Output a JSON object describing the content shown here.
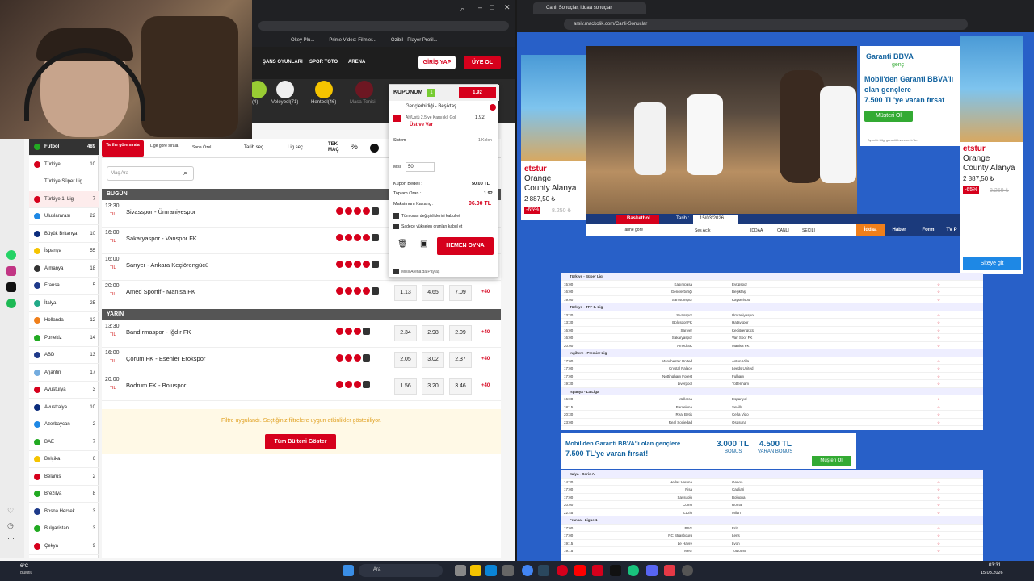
{
  "left_browser": {
    "bookmarks": [
      "Okey Plu...",
      "Prime Video: Filmler...",
      "Ozibil - Player Profil..."
    ],
    "header": {
      "nav": [
        "ŞANS OYUNLARI",
        "SPOR TOTO",
        "ARENA"
      ],
      "login": "GİRİŞ YAP",
      "signup": "ÜYE OL"
    },
    "sports": [
      {
        "label": "(4)"
      },
      {
        "label": "Voleybol(71)"
      },
      {
        "label": "Hentbol(46)"
      },
      {
        "label": "Masa Tenisi"
      }
    ],
    "filters": {
      "by_time": "Tarihe göre sırala",
      "by_league": "Lige göre sırala",
      "special": "Sana Özel",
      "date": "Tarih seç",
      "league": "Lig seç",
      "tek_mac": "TEK MAÇ",
      "search_placeholder": "Maç Ara"
    },
    "sidebar": [
      {
        "label": "Futbol",
        "count": "489"
      },
      {
        "label": "Türkiye",
        "count": "10"
      },
      {
        "label": "Türkiye Süper Lig",
        "count": ""
      },
      {
        "label": "Türkiye 1. Lig",
        "count": "7"
      },
      {
        "label": "Uluslararası",
        "count": "22"
      },
      {
        "label": "Büyük Britanya",
        "count": "10"
      },
      {
        "label": "İspanya",
        "count": "55"
      },
      {
        "label": "Almanya",
        "count": "18"
      },
      {
        "label": "Fransa",
        "count": "5"
      },
      {
        "label": "İtalya",
        "count": "25"
      },
      {
        "label": "Hollanda",
        "count": "12"
      },
      {
        "label": "Portekiz",
        "count": "14"
      },
      {
        "label": "ABD",
        "count": "13"
      },
      {
        "label": "Arjantin",
        "count": "17"
      },
      {
        "label": "Avusturya",
        "count": "3"
      },
      {
        "label": "Avustralya",
        "count": "10"
      },
      {
        "label": "Azerbaycan",
        "count": "2"
      },
      {
        "label": "BAE",
        "count": "7"
      },
      {
        "label": "Belçika",
        "count": "6"
      },
      {
        "label": "Belarus",
        "count": "2"
      },
      {
        "label": "Brezilya",
        "count": "8"
      },
      {
        "label": "Bosna Hersek",
        "count": "3"
      },
      {
        "label": "Bulgaristan",
        "count": "3"
      },
      {
        "label": "Çekya",
        "count": "9"
      }
    ],
    "today_label": "BUGÜN",
    "tomorrow_label": "YARIN",
    "today_matches": [
      {
        "time": "13:30",
        "tl": "TIL",
        "teams": "Sivasspor - Ümraniyespor",
        "o1": "",
        "ox": "",
        "o2": "",
        "plus": ""
      },
      {
        "time": "16:00",
        "tl": "TIL",
        "teams": "Sakaryaspor - Vanspor FK",
        "o1": "",
        "ox": "",
        "o2": "",
        "plus": ""
      },
      {
        "time": "16:00",
        "tl": "TIL",
        "teams": "Sarıyer - Ankara Keçiörengücü",
        "o1": "",
        "ox": "",
        "o2": "",
        "plus": ""
      },
      {
        "time": "20:00",
        "tl": "TIL",
        "teams": "Amed Sportif - Manisa FK",
        "o1": "1.13",
        "ox": "4.65",
        "o2": "7.09",
        "plus": "+40"
      }
    ],
    "tomorrow_matches": [
      {
        "time": "13:30",
        "tl": "TIL",
        "teams": "Bandırmaspor - Iğdır FK",
        "o1": "2.34",
        "ox": "2.98",
        "o2": "2.09",
        "plus": "+40"
      },
      {
        "time": "16:00",
        "tl": "TIL",
        "teams": "Çorum FK - Esenler Erokspor",
        "o1": "2.05",
        "ox": "3.02",
        "o2": "2.37",
        "plus": "+40"
      },
      {
        "time": "20:00",
        "tl": "TIL",
        "teams": "Bodrum FK - Boluspor",
        "o1": "1.56",
        "ox": "3.20",
        "o2": "3.46",
        "plus": "+40"
      }
    ],
    "filter_notice": "Filtre uygulandı. Seçtiğiniz filtrelere uygun etkinlikler gösteriliyor.",
    "all_bulletin": "Tüm Bülteni Göster",
    "coupon": {
      "title": "KUPONUM",
      "count": "1",
      "total_odd": "1.92",
      "match": "Gençlerbirliği - Beşiktaş",
      "bet": "Alt/Üstü 2.5 ve Karşılıklı Gol",
      "bet_odd": "1.92",
      "selection": "Üst ve Var",
      "system": "Sistem",
      "kolon": "1 Kolon",
      "misli_label": "Misli",
      "misli_value": "50",
      "bedel_label": "Kupon Bedeli :",
      "bedel_value": "50.00 TL",
      "oran_label": "Toplam Oran :",
      "oran_value": "1.92",
      "kazanc_label": "Maksimum Kazanç :",
      "kazanc_value": "96.00 TL",
      "check1": "Tüm oran değişikliklerini kabul et",
      "check2": "Sadece yükselen oranları kabul et",
      "play": "HEMEN OYNA",
      "share": "Misli Arena'da Paylaş"
    }
  },
  "right_browser": {
    "tab_title": "Canlı Sonuçlar, iddaa sonuçlar",
    "url": "arsiv.mackolik.com/Canli-Sonuclar",
    "ad_left": {
      "brand": "etstur",
      "line1": "Orange",
      "line2": "County Alanya",
      "price": "2 887,50 ₺",
      "discount": "-65%",
      "old": "8.250 ₺"
    },
    "ad_right": {
      "brand": "etstur",
      "line1": "Orange",
      "line2": "County Alanya",
      "price": "2 887,50 ₺",
      "discount": "-65%",
      "old": "8.250 ₺",
      "cta": "Siteye git"
    },
    "bbva": {
      "title": "Garanti BBVA",
      "sub": "genç",
      "line1": "Mobil'den Garanti BBVA'lı",
      "line2": "olan gençlere",
      "line3": "7.500 TL'ye varan fırsat",
      "cta": "Müşteri Ol",
      "small": "Ayrıntılı bilgi garantibbva.com.tr'de."
    },
    "toolbar": {
      "basketbol": "Basketbol",
      "tarih_label": "Tarih :",
      "date": "15/03/2026",
      "tarihe_gore": "Tarihe göre",
      "ses": "Ses Açık",
      "iddaa": "İDDAA",
      "canli": "CANLI",
      "secili": "SEÇİLİ",
      "tabs": [
        "İddaa",
        "Haber",
        "Form",
        "TV P"
      ]
    },
    "leagues1": [
      {
        "name": "Türkiye - Süper Lig",
        "rows": [
          [
            "15:00",
            "Kasımpaşa",
            "Eyüpspor"
          ],
          [
            "16:00",
            "Gençlerbirliği",
            "Beşiktaş"
          ],
          [
            "19:00",
            "Samsunspor",
            "Kayserispor"
          ]
        ]
      },
      {
        "name": "Türkiye - TFF 1. Lig",
        "rows": [
          [
            "13:30",
            "Sivasspor",
            "Ümraniyespor"
          ],
          [
            "13:30",
            "Boluspor FK",
            "Hatayspor"
          ],
          [
            "16:00",
            "Sarıyer",
            "Keçiörengücü"
          ],
          [
            "16:00",
            "Sakaryaspor",
            "Van Spor FK"
          ],
          [
            "20:00",
            "Amed SK",
            "Manisa FK"
          ]
        ]
      },
      {
        "name": "İngiltere - Premier Lig",
        "rows": [
          [
            "17:00",
            "Manchester United",
            "Aston Villa"
          ],
          [
            "17:00",
            "Crystal Palace",
            "Leeds United"
          ],
          [
            "17:00",
            "Nottingham Forest",
            "Fulham"
          ],
          [
            "19:30",
            "Liverpool",
            "Tottenham"
          ]
        ]
      },
      {
        "name": "İspanya - La Liga",
        "rows": [
          [
            "16:00",
            "Mallorca",
            "Espanyol"
          ],
          [
            "18:15",
            "Barcelona",
            "Sevilla"
          ],
          [
            "20:30",
            "Real Betis",
            "Celta Vigo"
          ],
          [
            "23:00",
            "Real Sociedad",
            "Osasuna"
          ]
        ]
      }
    ],
    "bbva_banner": {
      "line1": "Mobil'den Garanti BBVA'lı olan gençlere",
      "line2": "7.500 TL'ye varan fırsat!",
      "b1": "3.000 TL",
      "b1s": "BONUS",
      "b2": "4.500 TL",
      "b2s": "VARAN BONUS",
      "cta": "Müşteri Ol"
    },
    "leagues2": [
      {
        "name": "İtalya - Serie A",
        "rows": [
          [
            "14:30",
            "Hellas Verona",
            "Genoa"
          ],
          [
            "17:00",
            "Pisa",
            "Cagliari"
          ],
          [
            "17:00",
            "Sassuolo",
            "Bologna"
          ],
          [
            "20:00",
            "Como",
            "Roma"
          ],
          [
            "22:45",
            "Lazio",
            "Milan"
          ]
        ]
      },
      {
        "name": "Fransa - Ligue 1",
        "rows": [
          [
            "17:00",
            "PSG",
            "Erit."
          ],
          [
            "17:00",
            "RC Strasbourg",
            "Lens"
          ],
          [
            "19:15",
            "Le Havre",
            "Lyon"
          ],
          [
            "19:15",
            "Metz",
            "Toulouse"
          ]
        ]
      }
    ]
  },
  "taskbar": {
    "weather": "6°C",
    "weather_sub": "Bulutlu",
    "search": "Ara",
    "time": "03:31",
    "date": "15.03.2026"
  }
}
